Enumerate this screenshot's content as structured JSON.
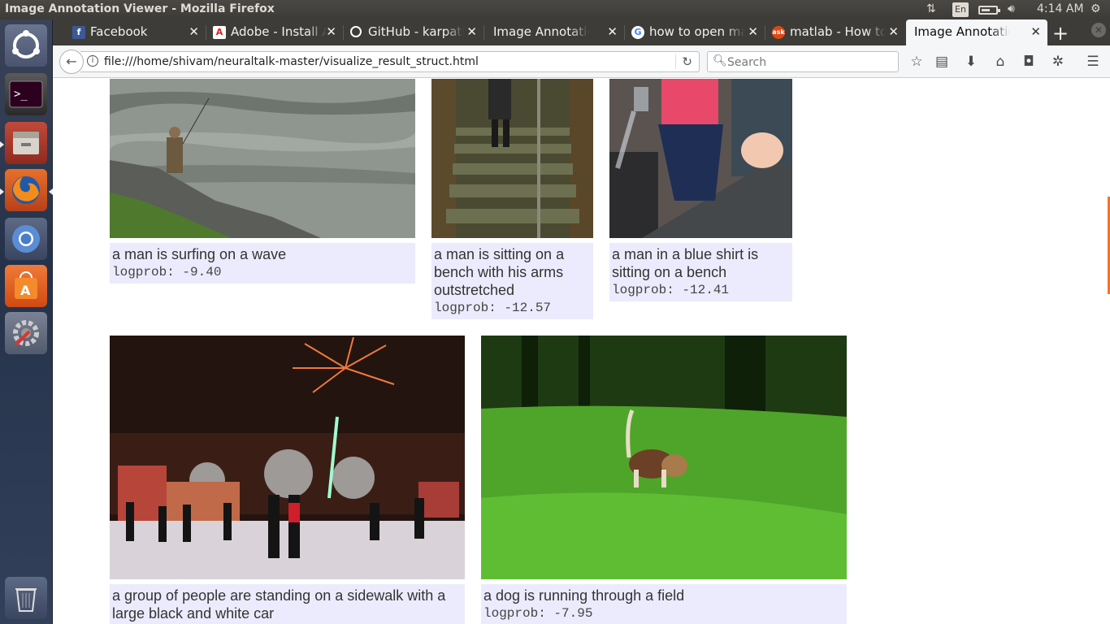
{
  "window": {
    "title": "Image Annotation Viewer - Mozilla Firefox",
    "clock": "4:14 AM",
    "keyboard_layout": "En"
  },
  "launcher": {
    "items": [
      {
        "name": "ubuntu-dash-icon"
      },
      {
        "name": "terminal-icon"
      },
      {
        "name": "files-icon"
      },
      {
        "name": "firefox-icon"
      },
      {
        "name": "chromium-icon"
      },
      {
        "name": "software-center-icon"
      },
      {
        "name": "system-settings-icon"
      },
      {
        "name": "trash-icon"
      }
    ]
  },
  "tabs": [
    {
      "label": "Facebook",
      "icon": "facebook-icon",
      "color": "#3b5998"
    },
    {
      "label": "Adobe - Install Adobe",
      "icon": "adobe-icon",
      "color": "#e21d1d"
    },
    {
      "label": "GitHub - karpathy/neu",
      "icon": "github-icon",
      "color": "#222222"
    },
    {
      "label": "Image Annotation Viewer",
      "icon": "",
      "color": ""
    },
    {
      "label": "how to open matlab in",
      "icon": "google-icon",
      "color": "#4285f4"
    },
    {
      "label": "matlab - How to open",
      "icon": "askubuntu-icon",
      "color": "#dd4814"
    },
    {
      "label": "Image Annotation Viewer",
      "icon": "",
      "color": "",
      "active": true
    }
  ],
  "navbar": {
    "url": "file:///home/shivam/neuraltalk-master/visualize_result_struct.html",
    "search_placeholder": "Search"
  },
  "results": [
    {
      "caption": "a man is surfing on a wave",
      "logprob": "logprob: -9.40",
      "image": "man-fishing-river-image"
    },
    {
      "caption": "a man is sitting on a bench with his arms outstretched",
      "logprob": "logprob: -12.57",
      "image": "person-walking-stairs-image"
    },
    {
      "caption": "a man in a blue shirt is sitting on a bench",
      "logprob": "logprob: -12.41",
      "image": "child-at-kitchen-sink-image"
    },
    {
      "caption": "a group of people are standing on a sidewalk with a large black and white car",
      "logprob": "",
      "image": "fireworks-crowd-night-image"
    },
    {
      "caption": "a dog is running through a field",
      "logprob": "logprob: -7.95",
      "image": "beagle-in-grass-image"
    }
  ],
  "colors": {
    "caption_bg": "#ecebfd",
    "tabbar_bg": "#3d3c39",
    "scroll_thumb": "#f3732f"
  }
}
